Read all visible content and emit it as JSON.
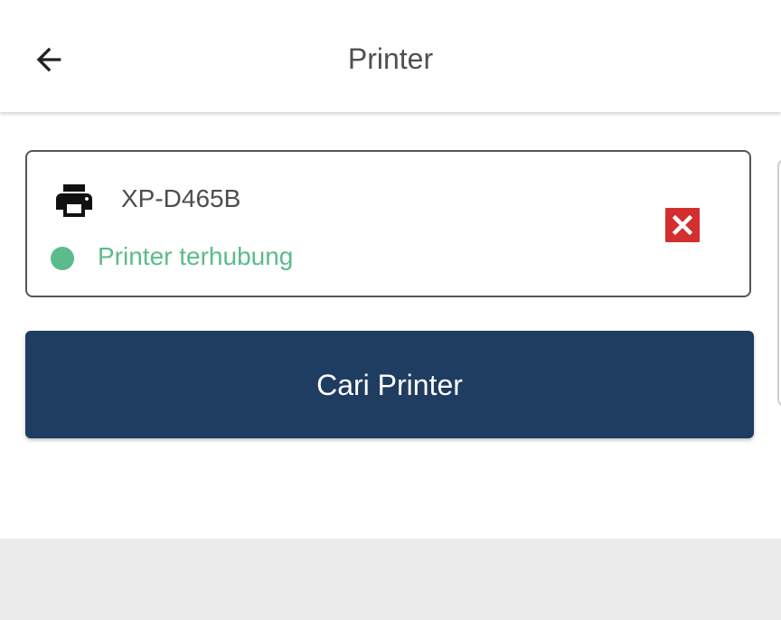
{
  "app_bar": {
    "title": "Printer",
    "back_icon": "arrow-left-icon"
  },
  "printer": {
    "icon": "printer-icon",
    "name": "XP-D465B",
    "status": "Printer terhubung",
    "status_color": "#5cbb8a",
    "remove_icon": "close-box-icon",
    "remove_color": "#d32f2f"
  },
  "actions": {
    "search_label": "Cari Printer",
    "search_color": "#1f3c61"
  },
  "colors": {
    "background": "#ffffff",
    "bottom_band": "#ebebeb"
  }
}
